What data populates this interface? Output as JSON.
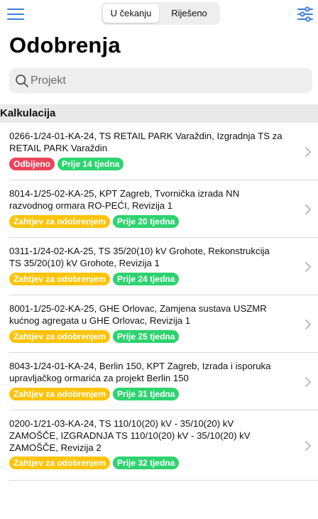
{
  "header": {
    "segments": [
      {
        "label": "U čekanju",
        "active": true
      },
      {
        "label": "Riješeno",
        "active": false
      }
    ],
    "accent_color": "#3b7ddd"
  },
  "title": "Odobrenja",
  "search": {
    "placeholder": "Projekt"
  },
  "section": {
    "label": "Kalkulacija"
  },
  "colors": {
    "rejected": "#eb445a",
    "pending": "#ffc409",
    "age": "#2dd36f"
  },
  "items": [
    {
      "title_lines": [
        "0266-1/24-01-KA-24, TS RETAIL PARK Varaždin, Izgradnja TS za",
        "RETAIL PARK Varaždin"
      ],
      "status": "Odbijeno",
      "status_type": "rejected",
      "age": "Prije 14 tjedna"
    },
    {
      "title_lines": [
        "8014-1/25-02-KA-25, KPT Zagreb, Tvornička izrada NN",
        "razvodnog ormara RO-PEĆI, Revizija 1"
      ],
      "status": "Zahtjev za odobrenjem",
      "status_type": "pending",
      "age": "Prije 20 tjedna"
    },
    {
      "title_lines": [
        "0311-1/24-02-KA-25, TS 35/20(10) kV Grohote, Rekonstrukcija",
        "TS 35/20(10) kV Grohote, Revizija 1"
      ],
      "status": "Zahtjev za odobrenjem",
      "status_type": "pending",
      "age": "Prije 24 tjedna"
    },
    {
      "title_lines": [
        "8001-1/25-02-KA-25, GHE Orlovac, Zamjena sustava USZMR",
        "kućnog agregata u GHE Orlovac, Revizija 1"
      ],
      "status": "Zahtjev za odobrenjem",
      "status_type": "pending",
      "age": "Prije 25 tjedna"
    },
    {
      "title_lines": [
        "8043-1/24-01-KA-24, Berlin 150, KPT Zagreb, Izrada i isporuka",
        "upravljačkog ormarića za projekt Berlin 150"
      ],
      "status": "Zahtjev za odobrenjem",
      "status_type": "pending",
      "age": "Prije 31 tjedna"
    },
    {
      "title_lines": [
        "0200-1/21-03-KA-24, TS 110/10(20) kV - 35/10(20) kV",
        "ZAMOŠČE, IZGRADNJA TS 110/10(20) kV - 35/10(20) kV",
        "ZAMOŠČE, Revizija 2"
      ],
      "status": "Zahtjev za odobrenjem",
      "status_type": "pending",
      "age": "Prije 32 tjedna"
    }
  ]
}
